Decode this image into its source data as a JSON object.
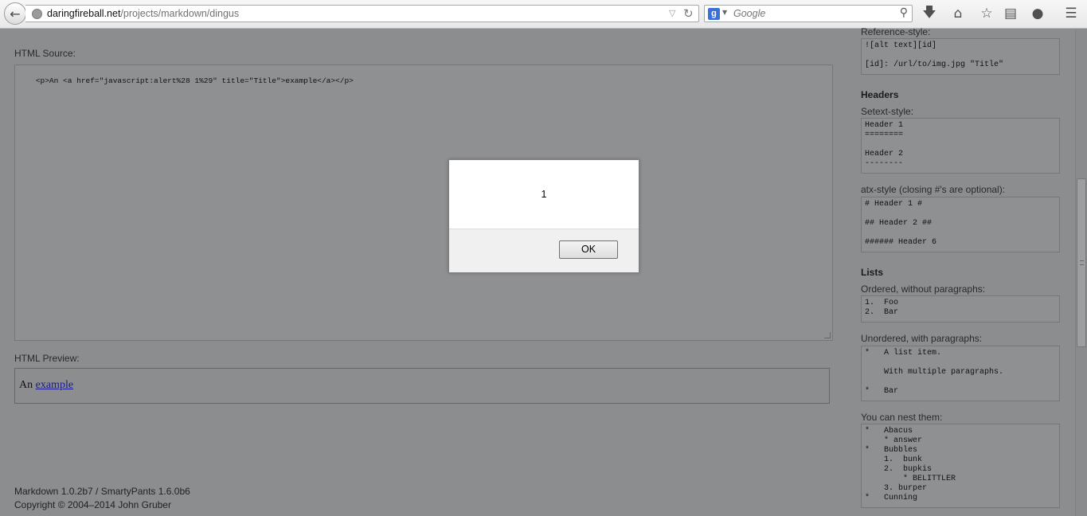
{
  "browser": {
    "url_domain": "daringfireball.net",
    "url_path": "/projects/markdown/dingus",
    "search_placeholder": "Google"
  },
  "main": {
    "html_source_label": "HTML Source:",
    "html_source_code": "<p>An <a href=\"javascript:alert%28 1%29\" title=\"Title\">example</a></p>",
    "html_preview_label": "HTML Preview:",
    "preview_prefix": "An",
    "preview_link": "example",
    "footer_line1": "Markdown 1.0.2b7 / SmartyPants 1.6.0b6",
    "footer_line2": "Copyright © 2004–2014 John Gruber"
  },
  "sidebar": {
    "ref_style_label": "Reference-style:",
    "ref_style_code": "![alt text][id]\n\n[id]: /url/to/img.jpg \"Title\"",
    "headers_heading": "Headers",
    "setext_label": "Setext-style:",
    "setext_code": "Header 1\n========\n\nHeader 2\n--------",
    "atx_label": "atx-style (closing #'s are optional):",
    "atx_code": "# Header 1 #\n\n## Header 2 ##\n\n###### Header 6",
    "lists_heading": "Lists",
    "ordered_label": "Ordered, without paragraphs:",
    "ordered_code": "1.  Foo\n2.  Bar",
    "unordered_label": "Unordered, with paragraphs:",
    "unordered_code": "*   A list item.\n\n    With multiple paragraphs.\n\n*   Bar",
    "nest_label": "You can nest them:",
    "nest_code": "*   Abacus\n    * answer\n*   Bubbles\n    1.  bunk\n    2.  bupkis\n        * BELITTLER\n    3. burper\n*   Cunning"
  },
  "dialog": {
    "message": "1",
    "ok_label": "OK"
  }
}
